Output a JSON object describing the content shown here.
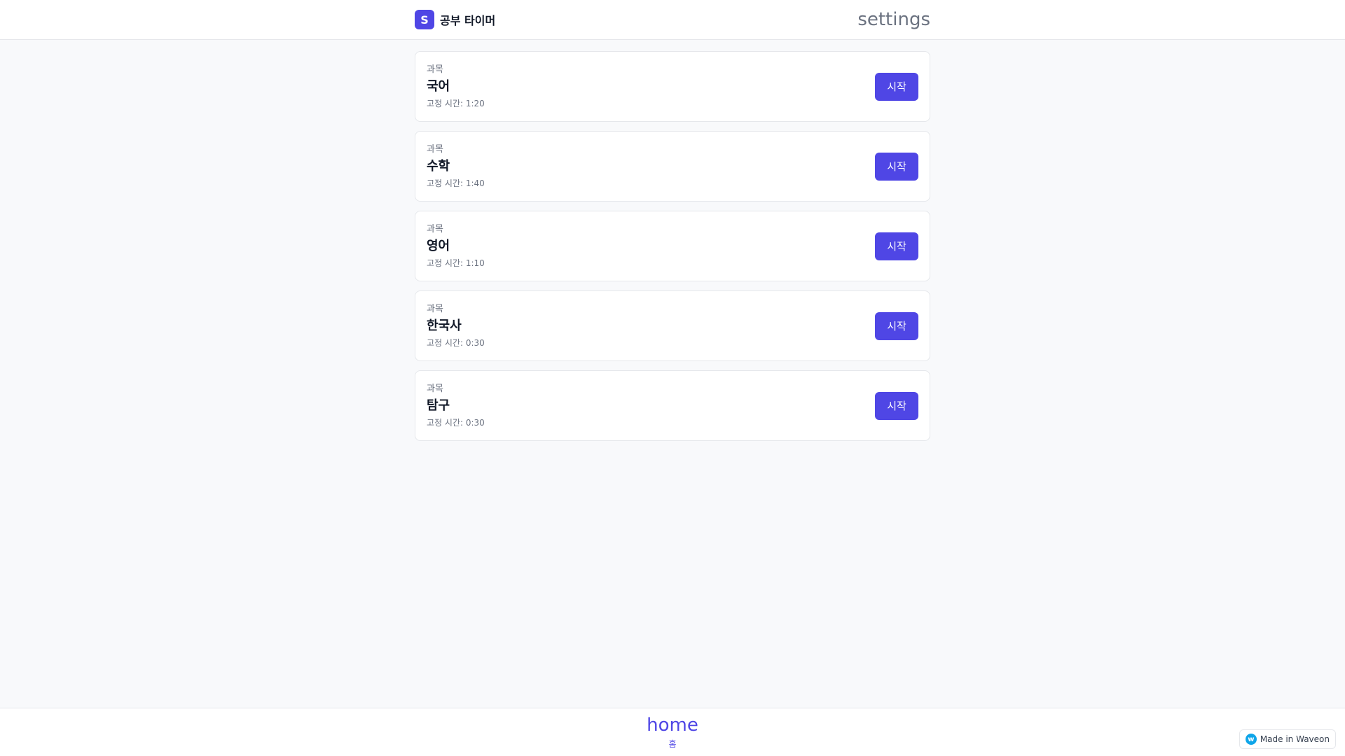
{
  "header": {
    "logo_letter": "S",
    "app_name": "공부 타이머",
    "settings_label": "settings"
  },
  "subjects": [
    {
      "label": "과목",
      "name": "국어",
      "time": "고정 시간: 1:20",
      "button": "시작"
    },
    {
      "label": "과목",
      "name": "수학",
      "time": "고정 시간: 1:40",
      "button": "시작"
    },
    {
      "label": "과목",
      "name": "영어",
      "time": "고정 시간: 1:10",
      "button": "시작"
    },
    {
      "label": "과목",
      "name": "한국사",
      "time": "고정 시간: 0:30",
      "button": "시작"
    },
    {
      "label": "과목",
      "name": "탐구",
      "time": "고정 시간: 0:30",
      "button": "시작"
    }
  ],
  "bottom_nav": {
    "icon_text": "home",
    "label": "홈"
  },
  "badge": {
    "icon_letter": "w",
    "text": "Made in Waveon"
  },
  "colors": {
    "accent": "#4f46e5",
    "background": "#f8f9fb"
  }
}
